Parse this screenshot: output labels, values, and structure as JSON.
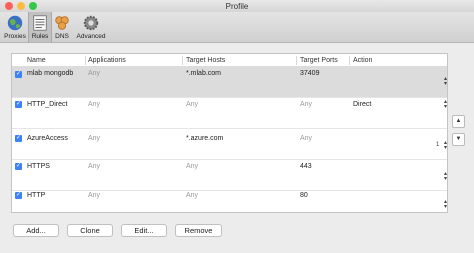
{
  "window": {
    "title": "Profile"
  },
  "toolbar": {
    "items": [
      {
        "label": "Proxies",
        "icon": "globe-icon"
      },
      {
        "label": "Rules",
        "icon": "rules-icon"
      },
      {
        "label": "DNS",
        "icon": "dns-icon"
      },
      {
        "label": "Advanced",
        "icon": "gear-icon"
      }
    ],
    "selected": "Rules"
  },
  "table": {
    "columns": [
      "Name",
      "Applications",
      "Target Hosts",
      "Target Ports",
      "Action"
    ],
    "rows": [
      {
        "enabled": true,
        "name": "mlab mongodb",
        "applications": "Any",
        "hosts": "*.mlab.com",
        "ports": "37409",
        "action": ""
      },
      {
        "enabled": true,
        "name": "HTTP_Direct",
        "applications": "Any",
        "hosts": "Any",
        "ports": "Any",
        "action": "Direct"
      },
      {
        "enabled": true,
        "name": "AzureAccess",
        "applications": "Any",
        "hosts": "*.azure.com",
        "ports": "Any",
        "action": ""
      },
      {
        "enabled": true,
        "name": "HTTPS",
        "applications": "Any",
        "hosts": "Any",
        "ports": "443",
        "action": ""
      },
      {
        "enabled": true,
        "name": "HTTP",
        "applications": "Any",
        "hosts": "Any",
        "ports": "80",
        "action": ""
      }
    ],
    "stepper_value": "1"
  },
  "buttons": {
    "add": "Add...",
    "clone": "Clone",
    "edit": "Edit...",
    "remove": "Remove"
  },
  "colors": {
    "checkbox": "#3d82f7",
    "selected_row": "#dcdcdc"
  }
}
